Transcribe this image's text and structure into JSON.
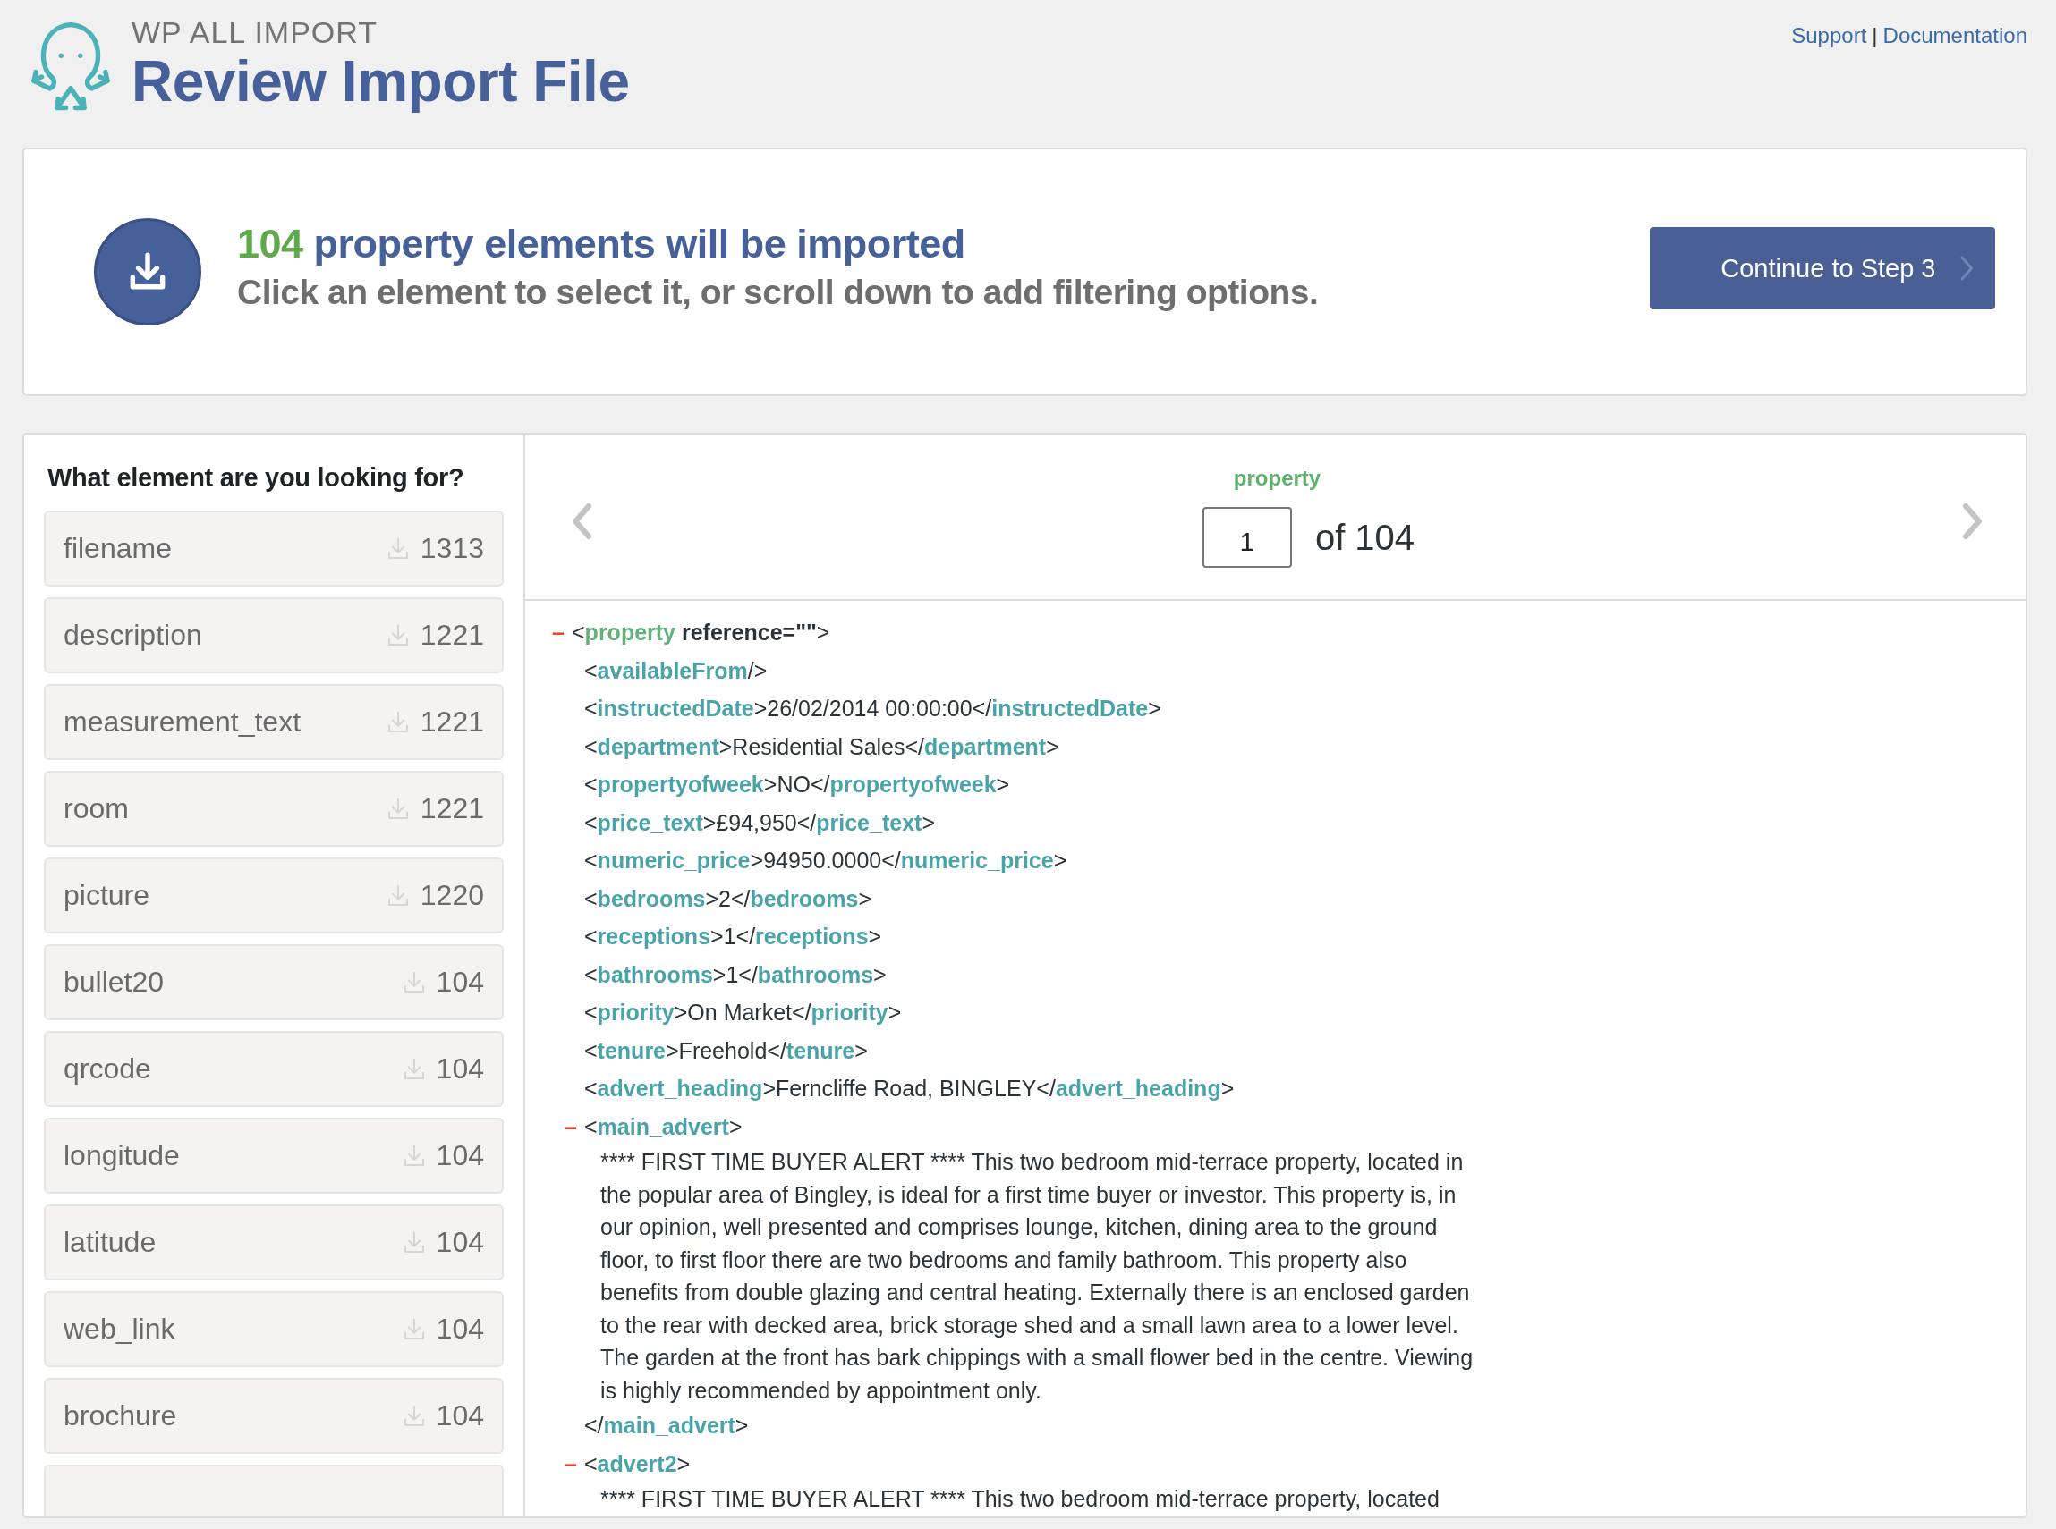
{
  "header": {
    "brand": "WP ALL IMPORT",
    "title": "Review Import File",
    "links": [
      {
        "label": "Support"
      },
      {
        "label": "Documentation"
      }
    ],
    "separator": "|"
  },
  "summary": {
    "count": "104",
    "headline": "property elements will be imported",
    "subtitle": "Click an element to select it, or scroll down to add filtering options.",
    "button": "Continue to Step 3"
  },
  "sidebar": {
    "heading": "What element are you looking for?",
    "items": [
      {
        "name": "filename",
        "count": "1313"
      },
      {
        "name": "description",
        "count": "1221"
      },
      {
        "name": "measurement_text",
        "count": "1221"
      },
      {
        "name": "room",
        "count": "1221"
      },
      {
        "name": "picture",
        "count": "1220"
      },
      {
        "name": "bullet20",
        "count": "104"
      },
      {
        "name": "qrcode",
        "count": "104"
      },
      {
        "name": "longitude",
        "count": "104"
      },
      {
        "name": "latitude",
        "count": "104"
      },
      {
        "name": "web_link",
        "count": "104"
      },
      {
        "name": "brochure",
        "count": "104"
      }
    ],
    "partial_item_below": true
  },
  "viewer": {
    "element": "property",
    "index": "1",
    "of": "of 104",
    "root": {
      "toggle": "–",
      "open": "<**property** **reference=\"\"**>",
      "children": [
        {
          "kind": "line",
          "text": "<**availableFrom**/>"
        },
        {
          "kind": "line",
          "text": "<**instructedDate**>26/02/2014 00:00:00</**instructedDate**>"
        },
        {
          "kind": "line",
          "text": "<**department**>Residential Sales</**department**>"
        },
        {
          "kind": "line",
          "text": "<**propertyofweek**>NO</**propertyofweek**>"
        },
        {
          "kind": "line",
          "text": "<**price_text**>£94,950</**price_text**>"
        },
        {
          "kind": "line",
          "text": "<**numeric_price**>94950.0000</**numeric_price**>"
        },
        {
          "kind": "line",
          "text": "<**bedrooms**>2</**bedrooms**>"
        },
        {
          "kind": "line",
          "text": "<**receptions**>1</**receptions**>"
        },
        {
          "kind": "line",
          "text": "<**bathrooms**>1</**bathrooms**>"
        },
        {
          "kind": "line",
          "text": "<**priority**>On Market</**priority**>"
        },
        {
          "kind": "line",
          "text": "<**tenure**>Freehold</**tenure**>"
        },
        {
          "kind": "line",
          "text": "<**advert_heading**>Ferncliffe Road, BINGLEY</**advert_heading**>"
        },
        {
          "kind": "block",
          "toggle": "–",
          "open": "<**main_advert**>",
          "text": "**** FIRST TIME BUYER ALERT **** This two bedroom mid-terrace property, located in the popular area of Bingley, is ideal for a first time buyer or investor. This property is, in our opinion, well presented and comprises lounge, kitchen, dining area to the ground floor, to first floor there are two bedrooms and family bathroom. This property also benefits from double glazing and central heating. Externally there is an enclosed garden to the rear with decked area, brick storage shed and a small lawn area to a lower level. The garden at the front has bark chippings with a small flower bed in the centre. Viewing is highly recommended by appointment only.",
          "close": "</**main_advert**>"
        },
        {
          "kind": "block",
          "toggle": "–",
          "open": "<**advert2**>",
          "text": "**** FIRST TIME BUYER ALERT **** This two bedroom mid-terrace property, located"
        }
      ]
    }
  }
}
